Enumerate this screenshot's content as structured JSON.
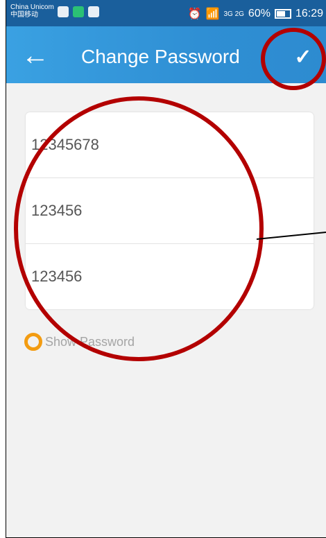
{
  "status_bar": {
    "carrier_line1": "China Unicom",
    "carrier_line2": "中国移动",
    "network": "3G 2G",
    "battery": "60%",
    "time": "16:29"
  },
  "app_bar": {
    "title": "Change Password",
    "back_icon": "arrow-left-icon",
    "confirm_icon": "check-icon"
  },
  "form": {
    "fields": [
      {
        "value": "12345678"
      },
      {
        "value": "123456"
      },
      {
        "value": "123456"
      }
    ]
  },
  "show_password": {
    "label": "Show Password",
    "checked": false
  },
  "colors": {
    "status_bar": "#1a5f9c",
    "app_bar": "#3498db",
    "radio": "#f39c12",
    "annotation": "#b30000"
  }
}
